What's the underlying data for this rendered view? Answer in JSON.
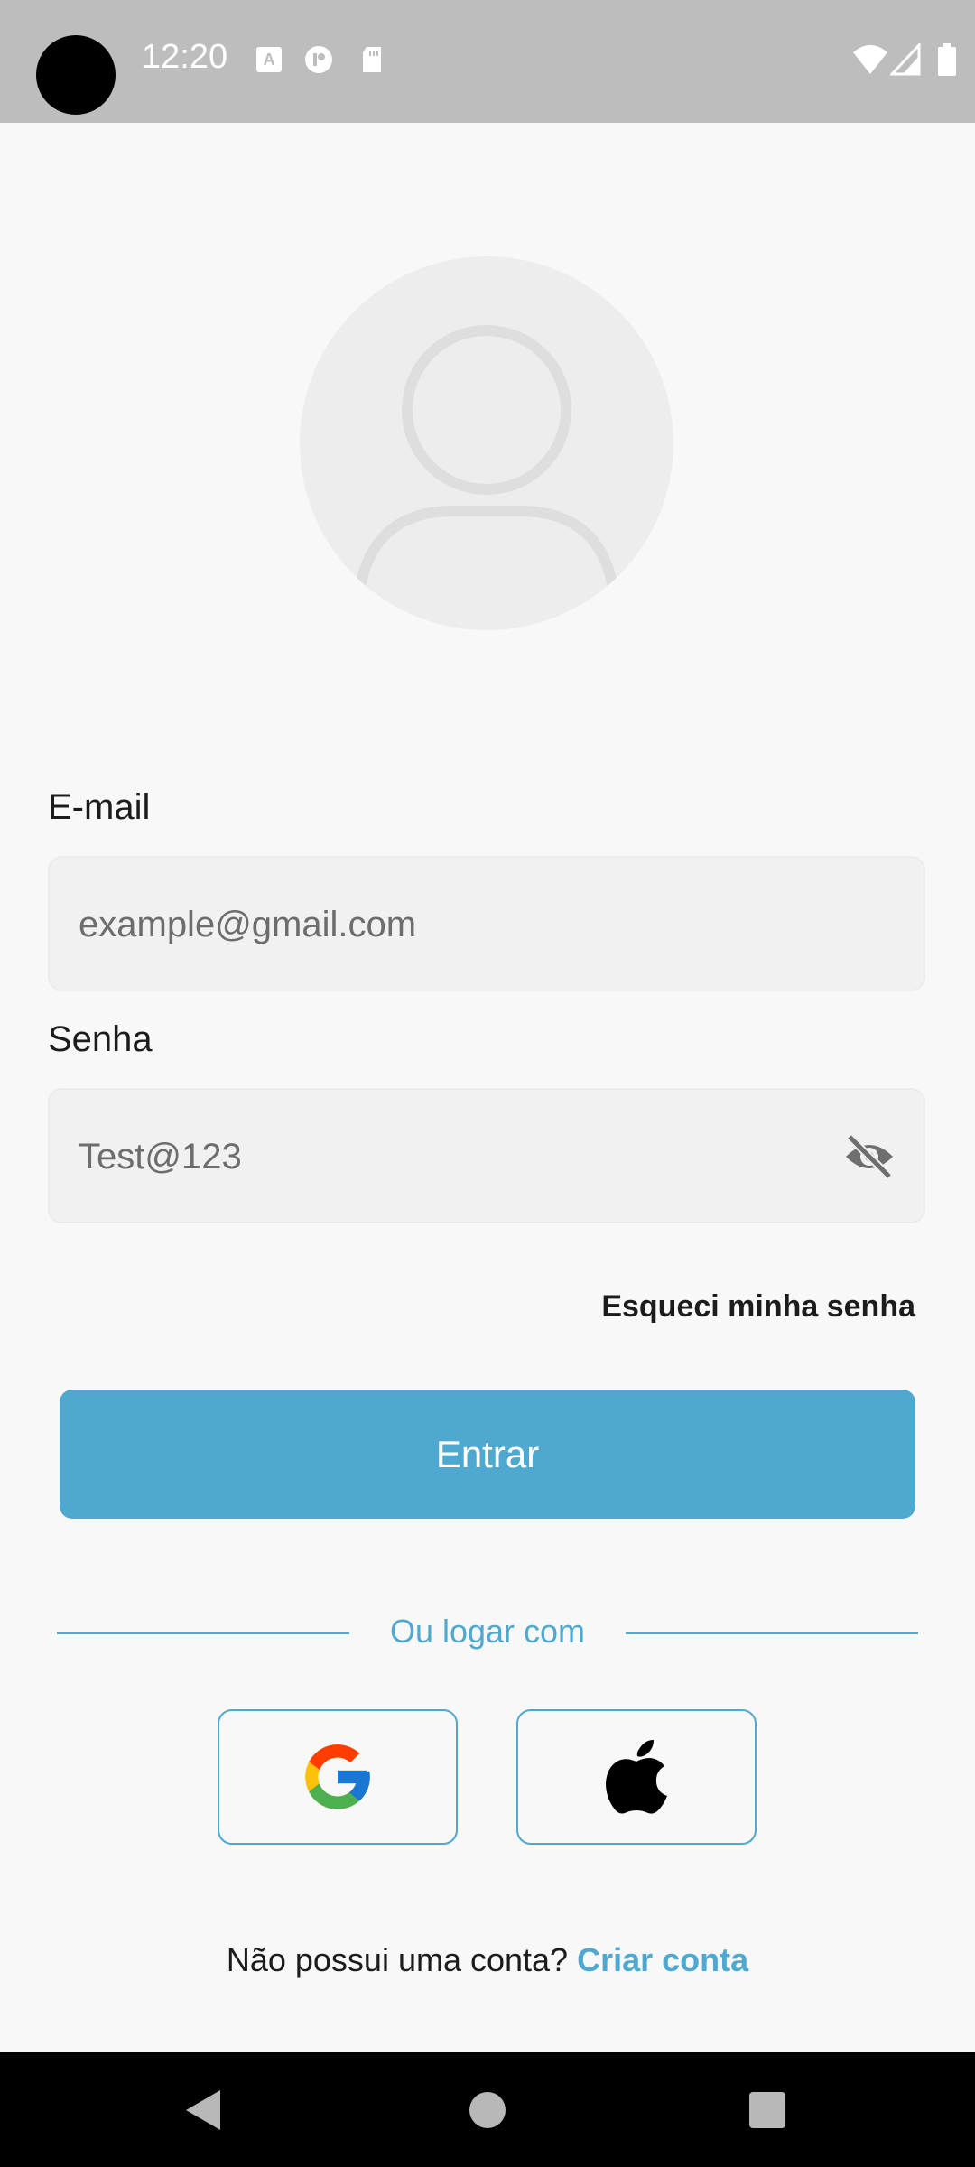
{
  "status_bar": {
    "time": "12:20",
    "icons": [
      "text-a-icon",
      "status-circle-icon",
      "sd-card-icon",
      "wifi-icon",
      "signal-icon",
      "battery-icon"
    ]
  },
  "login": {
    "avatar_icon": "user-placeholder-icon",
    "email_label": "E-mail",
    "email_placeholder": "example@gmail.com",
    "password_label": "Senha",
    "password_placeholder": "Test@123",
    "forgot_password": "Esqueci minha senha",
    "submit_label": "Entrar",
    "divider_text": "Ou logar com",
    "social": [
      {
        "name": "google",
        "icon": "google-icon"
      },
      {
        "name": "apple",
        "icon": "apple-icon"
      }
    ],
    "signup_prompt": "Não possui uma conta?",
    "signup_link": "Criar conta"
  },
  "colors": {
    "accent": "#4fa8d0",
    "background": "#f8f8f8",
    "field_bg": "#f1f1f1",
    "status_bar": "#bdbdbd"
  }
}
